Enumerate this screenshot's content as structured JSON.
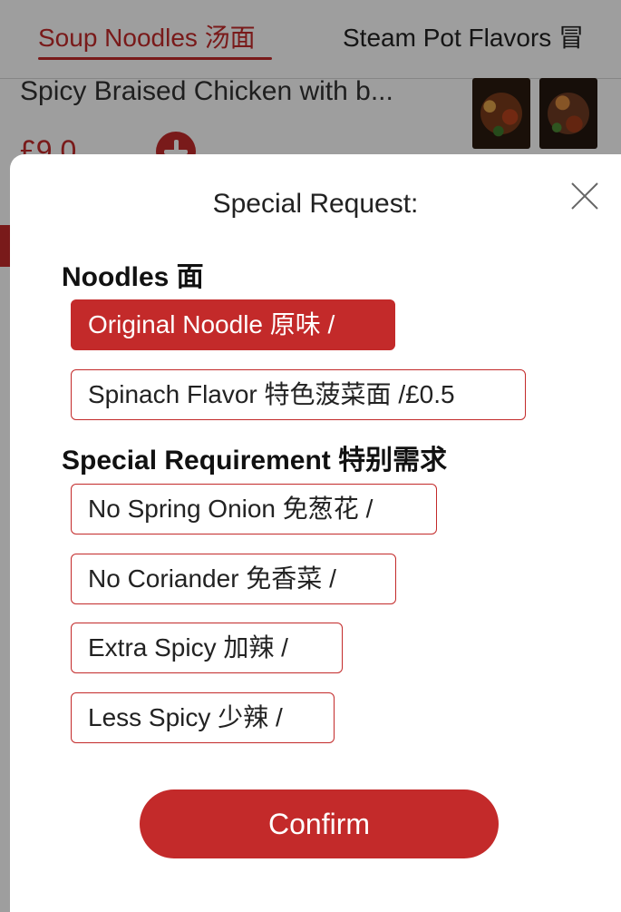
{
  "tabs": [
    {
      "label": "Soup Noodles 汤面",
      "active": true
    },
    {
      "label": "Steam Pot Flavors 冒",
      "active": false
    }
  ],
  "product": {
    "title": "Spicy Braised Chicken with b...",
    "price": "£9.0"
  },
  "modal": {
    "title": "Special Request:",
    "close_icon": "close-icon",
    "sections": [
      {
        "heading": "Noodles 面",
        "options": [
          {
            "label": "Original Noodle 原味 /",
            "selected": true
          },
          {
            "label": "Spinach Flavor 特色菠菜面 /£0.5",
            "selected": false
          }
        ]
      },
      {
        "heading": "Special Requirement 特别需求",
        "options": [
          {
            "label": "No Spring Onion 免葱花 /",
            "selected": false
          },
          {
            "label": "No Coriander 免香菜 /",
            "selected": false
          },
          {
            "label": "Extra Spicy 加辣 /",
            "selected": false
          },
          {
            "label": "Less Spicy 少辣 /",
            "selected": false
          }
        ]
      }
    ],
    "confirm_label": "Confirm"
  },
  "colors": {
    "accent": "#c32a2a",
    "overlay": "rgba(0,0,0,0.38)"
  }
}
